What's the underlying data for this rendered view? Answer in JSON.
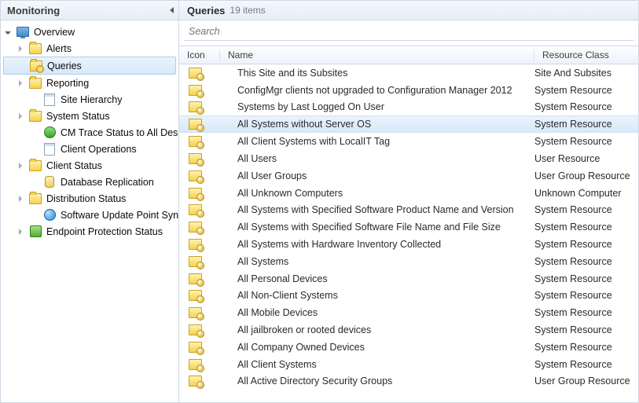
{
  "sidebar": {
    "title": "Monitoring",
    "nodes": [
      {
        "label": "Overview",
        "level": 0,
        "arrow": "open",
        "icon": "monitor"
      },
      {
        "label": "Alerts",
        "level": 1,
        "arrow": "closed",
        "icon": "folder"
      },
      {
        "label": "Queries",
        "level": 1,
        "arrow": "",
        "icon": "folder-queries",
        "selected": true
      },
      {
        "label": "Reporting",
        "level": 1,
        "arrow": "closed",
        "icon": "folder"
      },
      {
        "label": "Site Hierarchy",
        "level": 2,
        "arrow": "",
        "icon": "page"
      },
      {
        "label": "System Status",
        "level": 1,
        "arrow": "closed",
        "icon": "folder"
      },
      {
        "label": "CM Trace Status to All Desktop .",
        "level": 2,
        "arrow": "",
        "icon": "flag"
      },
      {
        "label": "Client Operations",
        "level": 2,
        "arrow": "",
        "icon": "page"
      },
      {
        "label": "Client Status",
        "level": 1,
        "arrow": "closed",
        "icon": "folder"
      },
      {
        "label": "Database Replication",
        "level": 2,
        "arrow": "",
        "icon": "db"
      },
      {
        "label": "Distribution Status",
        "level": 1,
        "arrow": "closed",
        "icon": "folder"
      },
      {
        "label": "Software Update Point Synchron",
        "level": 2,
        "arrow": "",
        "icon": "globe"
      },
      {
        "label": "Endpoint Protection Status",
        "level": 1,
        "arrow": "closed",
        "icon": "green"
      }
    ]
  },
  "main": {
    "title": "Queries",
    "count": "19 items",
    "search_placeholder": "Search",
    "columns": {
      "icon": "Icon",
      "name": "Name",
      "resource": "Resource Class"
    },
    "rows": [
      {
        "name": "This Site and its Subsites",
        "resource": "Site And Subsites"
      },
      {
        "name": "ConfigMgr clients not upgraded to Configuration Manager 2012",
        "resource": "System Resource"
      },
      {
        "name": "Systems by Last Logged On User",
        "resource": "System Resource"
      },
      {
        "name": "All Systems without Server OS",
        "resource": "System Resource",
        "highlight": true
      },
      {
        "name": "All Client Systems with LocalIT Tag",
        "resource": "System Resource"
      },
      {
        "name": "All Users",
        "resource": "User Resource"
      },
      {
        "name": "All User Groups",
        "resource": "User Group Resource"
      },
      {
        "name": "All Unknown Computers",
        "resource": "Unknown Computer"
      },
      {
        "name": "All Systems with Specified Software Product Name and Version",
        "resource": "System Resource"
      },
      {
        "name": "All Systems with Specified Software File Name and File Size",
        "resource": "System Resource"
      },
      {
        "name": "All Systems with Hardware Inventory Collected",
        "resource": "System Resource"
      },
      {
        "name": "All Systems",
        "resource": "System Resource"
      },
      {
        "name": "All Personal Devices",
        "resource": "System Resource"
      },
      {
        "name": "All Non-Client Systems",
        "resource": "System Resource"
      },
      {
        "name": "All Mobile Devices",
        "resource": "System Resource"
      },
      {
        "name": "All jailbroken or rooted devices",
        "resource": "System Resource"
      },
      {
        "name": "All Company Owned Devices",
        "resource": "System Resource"
      },
      {
        "name": "All Client Systems",
        "resource": "System Resource"
      },
      {
        "name": "All Active Directory Security Groups",
        "resource": "User Group Resource"
      }
    ]
  }
}
